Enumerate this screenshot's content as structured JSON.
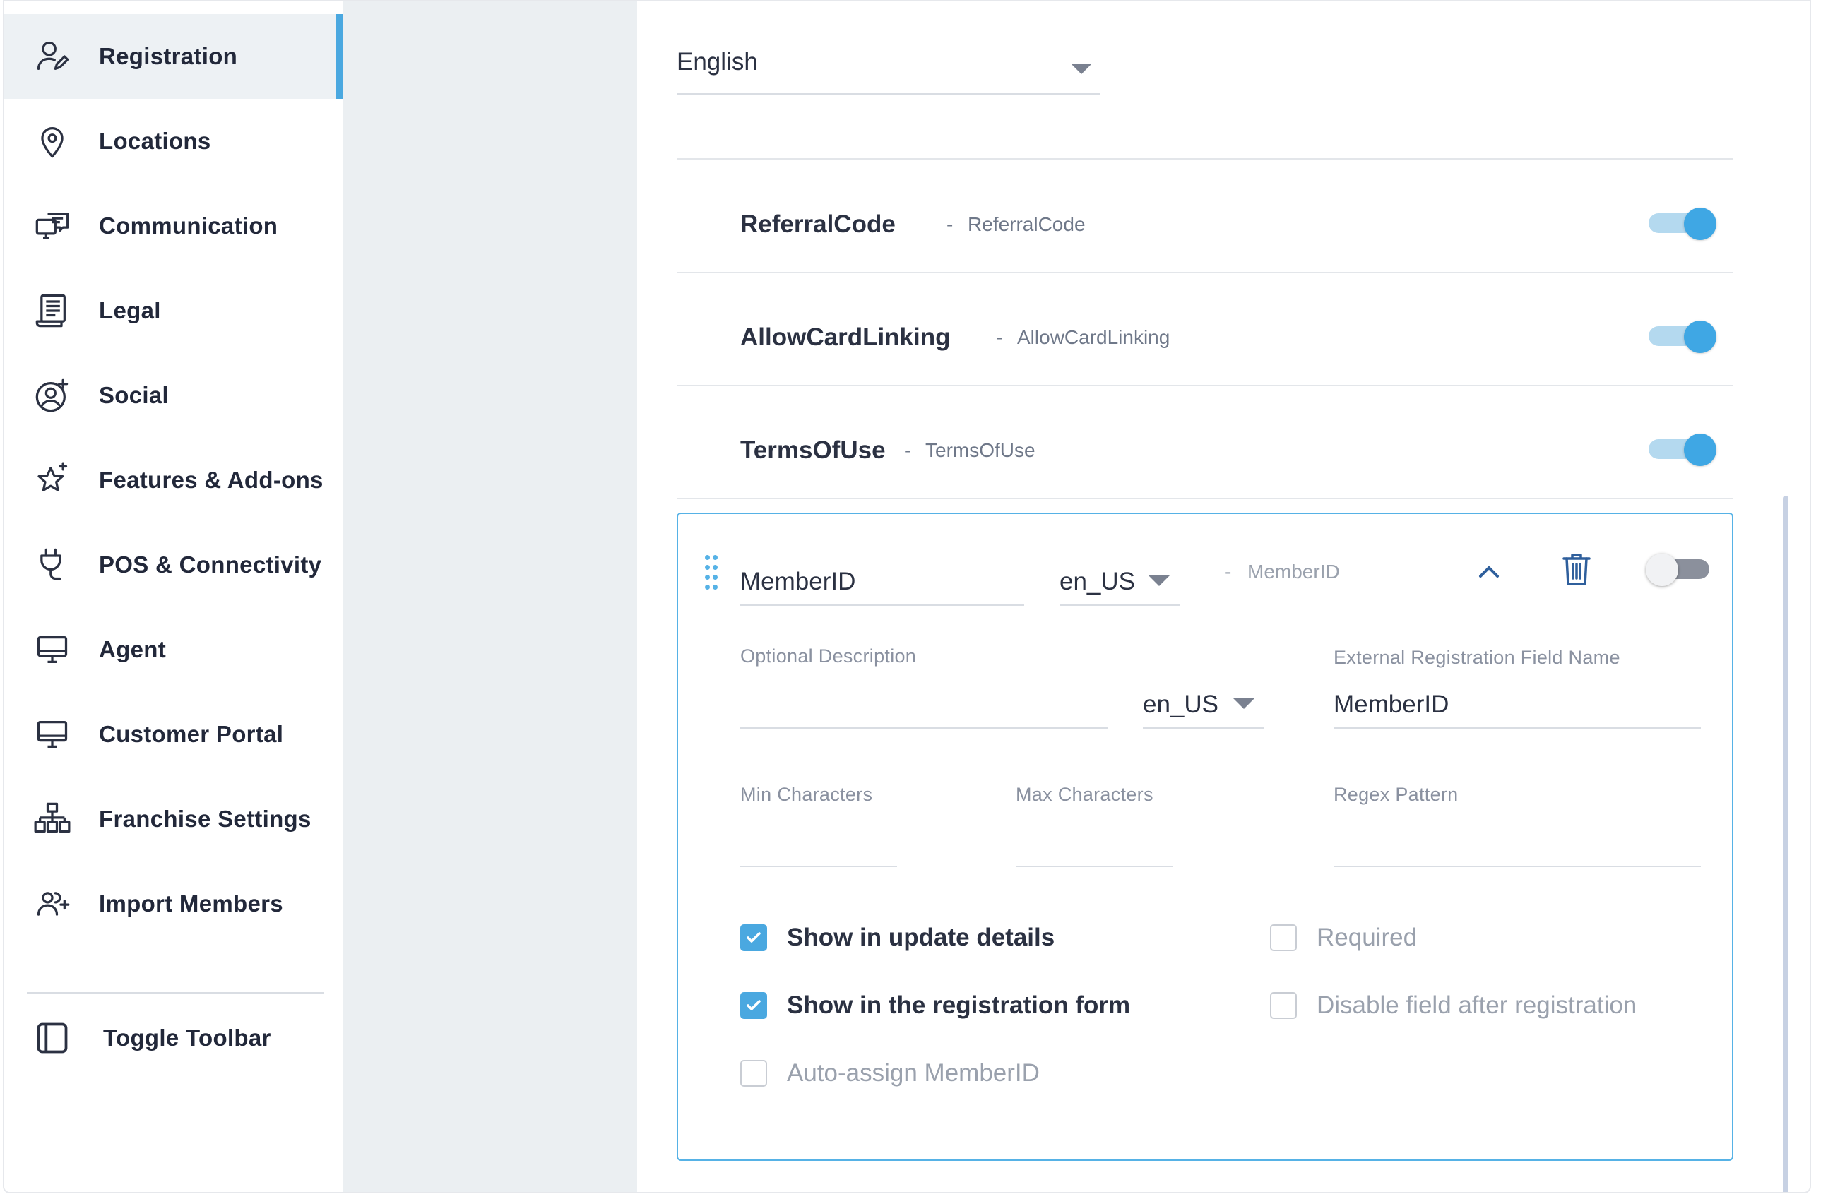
{
  "sidebar": {
    "items": [
      {
        "label": "Registration",
        "icon": "user-edit-icon",
        "active": true
      },
      {
        "label": "Locations",
        "icon": "location-pin-icon"
      },
      {
        "label": "Communication",
        "icon": "chat-monitor-icon"
      },
      {
        "label": "Legal",
        "icon": "document-icon"
      },
      {
        "label": "Social",
        "icon": "user-circle-add-icon"
      },
      {
        "label": "Features & Add-ons",
        "icon": "star-add-icon"
      },
      {
        "label": "POS & Connectivity",
        "icon": "plug-icon"
      },
      {
        "label": "Agent",
        "icon": "monitor-icon"
      },
      {
        "label": "Customer Portal",
        "icon": "monitor-icon"
      },
      {
        "label": "Franchise Settings",
        "icon": "store-network-icon"
      },
      {
        "label": "Import Members",
        "icon": "users-add-icon"
      }
    ],
    "toggle_toolbar": {
      "label": "Toggle Toolbar",
      "icon": "sidebar-panel-icon"
    }
  },
  "main": {
    "language_select": {
      "value": "English"
    },
    "fields": [
      {
        "name": "ReferralCode",
        "separator": "-",
        "key": "ReferralCode",
        "enabled": true
      },
      {
        "name": "AllowCardLinking",
        "separator": "-",
        "key": "AllowCardLinking",
        "enabled": true
      },
      {
        "name": "TermsOfUse",
        "separator": "-",
        "key": "TermsOfUse",
        "enabled": true
      }
    ],
    "expanded": {
      "name_value": "MemberID",
      "locale_value": "en_US",
      "separator": "-",
      "key": "MemberID",
      "enabled": false,
      "optional_description_label": "Optional Description",
      "optional_description_value": "",
      "description_locale_value": "en_US",
      "external_name_label": "External Registration Field Name",
      "external_name_value": "MemberID",
      "min_chars_label": "Min Characters",
      "max_chars_label": "Max Characters",
      "regex_label": "Regex Pattern",
      "checkboxes": [
        {
          "label": "Show in update details",
          "checked": true
        },
        {
          "label": "Required",
          "checked": false
        },
        {
          "label": "Show in the registration form",
          "checked": true
        },
        {
          "label": "Disable field after registration",
          "checked": false
        },
        {
          "label": "Auto-assign MemberID",
          "checked": false
        }
      ]
    }
  },
  "colors": {
    "accent": "#4aa8e0",
    "active_bg": "#edf1f4",
    "gutter": "#ebeff2"
  }
}
